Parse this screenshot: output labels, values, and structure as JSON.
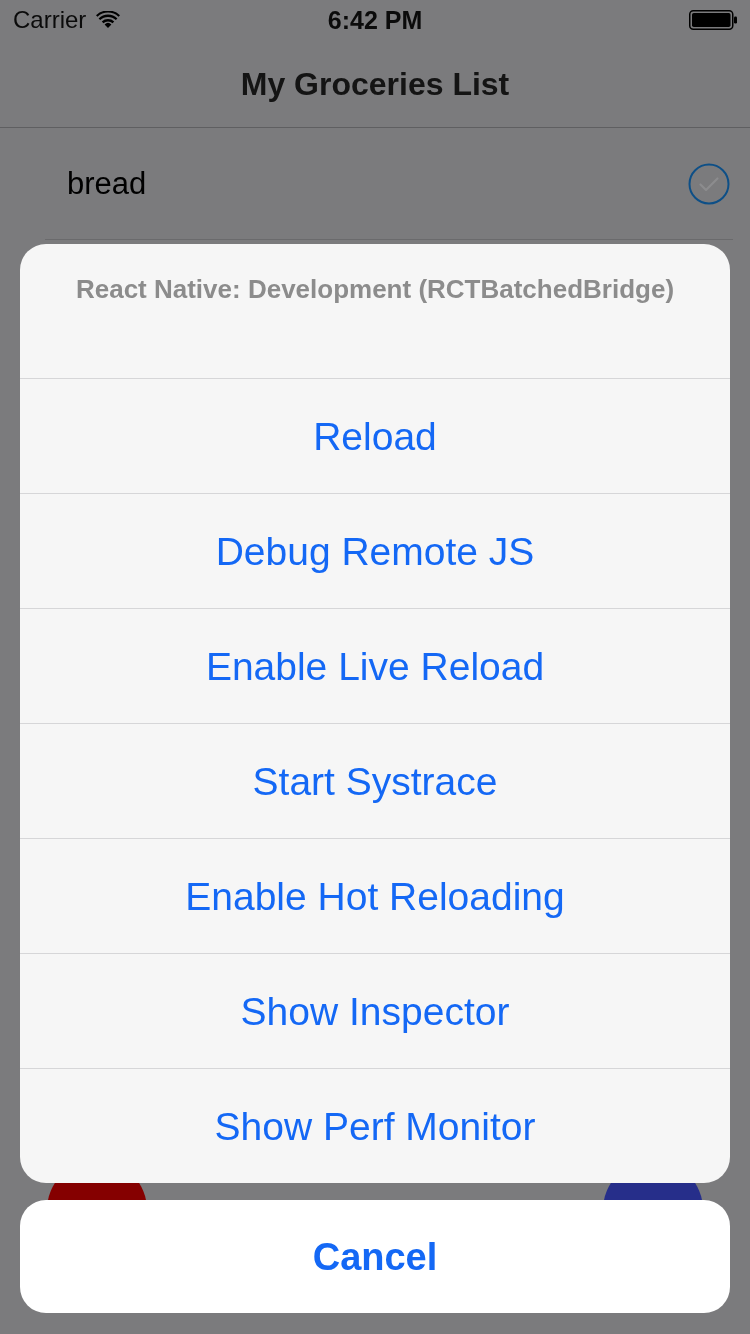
{
  "status_bar": {
    "carrier": "Carrier",
    "time": "6:42 PM"
  },
  "nav_bar": {
    "title": "My Groceries List"
  },
  "list": {
    "items": [
      {
        "name": "bread",
        "checked": false
      }
    ]
  },
  "floating_buttons": [
    {
      "color": "#850000"
    },
    {
      "color": "#262e8a"
    }
  ],
  "action_sheet": {
    "title": "React Native: Development (RCTBatchedBridge)",
    "actions": [
      "Reload",
      "Debug Remote JS",
      "Enable Live Reload",
      "Start Systrace",
      "Enable Hot Reloading",
      "Show Inspector",
      "Show Perf Monitor"
    ],
    "cancel": "Cancel"
  }
}
